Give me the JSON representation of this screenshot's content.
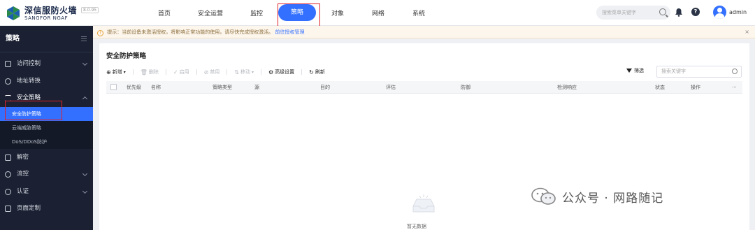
{
  "brand": {
    "name_cn": "深信服防火墙",
    "name_en": "SANGFOR NGAF",
    "version": "8.0.95"
  },
  "nav": {
    "items": [
      "首页",
      "安全运营",
      "监控",
      "策略",
      "对象",
      "网络",
      "系统"
    ],
    "active": "策略"
  },
  "top_search": {
    "placeholder": "搜索菜单关键字"
  },
  "user": {
    "name": "admin"
  },
  "sidebar": {
    "title": "策略",
    "items": [
      {
        "label": "访问控制",
        "icon": "access-control-icon",
        "expandable": true
      },
      {
        "label": "地址转换",
        "icon": "globe-icon",
        "expandable": false
      },
      {
        "label": "安全策略",
        "icon": "list-icon",
        "expandable": true,
        "expanded": true,
        "children": [
          "安全防护策略",
          "云端威胁策略",
          "DoS/DDoS防护"
        ]
      },
      {
        "label": "解密",
        "icon": "lock-icon",
        "expandable": false
      },
      {
        "label": "流控",
        "icon": "flow-icon",
        "expandable": true
      },
      {
        "label": "认证",
        "icon": "shield-icon",
        "expandable": true
      },
      {
        "label": "页面定制",
        "icon": "page-icon",
        "expandable": false
      }
    ],
    "active_child": "安全防护策略"
  },
  "notice": {
    "text": "提示：当前设备未激活授权，将影响正常功能的使用，请尽快完成授权激活。",
    "link": "前往授权管理",
    "close": "×"
  },
  "panel": {
    "title": "安全防护策略",
    "toolbar": {
      "new": "新增",
      "delete": "删除",
      "enable": "启用",
      "disable": "禁用",
      "move": "移动",
      "advanced": "高级设置",
      "refresh": "刷新"
    },
    "filter": {
      "label": "筛选",
      "placeholder": "搜索关键字"
    },
    "columns": [
      "优先级",
      "名称",
      "策略类型",
      "源",
      "目的",
      "评估",
      "防御",
      "检测响应",
      "状态",
      "操作",
      "···"
    ],
    "empty_text": "暂无数据"
  },
  "watermark": {
    "text": "公众号 · 网路随记"
  },
  "colors": {
    "primary": "#3370ff",
    "sidebar_bg": "#1b2133",
    "highlight_box": "#e0202a"
  }
}
